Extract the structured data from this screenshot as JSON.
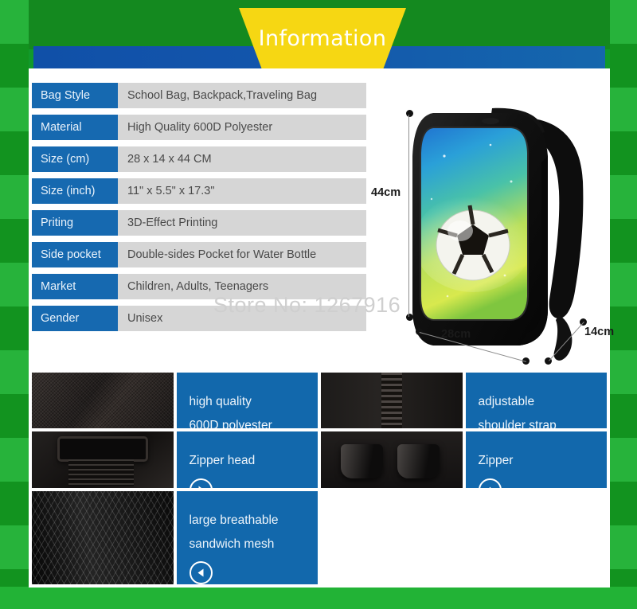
{
  "header": {
    "title": "Information"
  },
  "watermark": {
    "text": "Store No: 1267916"
  },
  "spec_table": {
    "rows": [
      {
        "label": "Bag Style",
        "value": "School Bag, Backpack,Traveling Bag"
      },
      {
        "label": "Material",
        "value": "High Quality 600D Polyester"
      },
      {
        "label": "Size (cm)",
        "value": "28 x 14 x 44 CM"
      },
      {
        "label": "Size (inch)",
        "value": "11\" x 5.5\" x 17.3\""
      },
      {
        "label": "Priting",
        "value": "3D-Effect Printing"
      },
      {
        "label": "Side pocket",
        "value": "Double-sides Pocket for Water Bottle"
      },
      {
        "label": "Market",
        "value": "Children, Adults, Teenagers"
      },
      {
        "label": "Gender",
        "value": "Unisex"
      }
    ]
  },
  "diagram": {
    "height_label": "44cm",
    "width_label": "28cm",
    "depth_label": "14cm"
  },
  "features": [
    {
      "kind": "photo",
      "texture": "weave",
      "name": "fabric-closeup-photo"
    },
    {
      "kind": "caption",
      "lines": [
        "high quality",
        "600D polyester"
      ],
      "arrow": "left",
      "name": "feature-600d-polyester"
    },
    {
      "kind": "photo",
      "texture": "zipper",
      "name": "zipper-track-photo"
    },
    {
      "kind": "caption",
      "lines": [
        "adjustable",
        "shoulder strap"
      ],
      "arrow": "right",
      "name": "feature-adjustable-shoulder-strap"
    },
    {
      "kind": "photo",
      "texture": "strap",
      "name": "shoulder-strap-buckle-photo"
    },
    {
      "kind": "caption",
      "lines": [
        "Zipper head"
      ],
      "arrow": "right",
      "name": "feature-zipper-head"
    },
    {
      "kind": "photo",
      "texture": "zhead",
      "name": "zipper-head-photo"
    },
    {
      "kind": "caption",
      "lines": [
        "Zipper"
      ],
      "arrow": "up",
      "name": "feature-zipper"
    },
    {
      "kind": "photo",
      "texture": "mesh",
      "name": "sandwich-mesh-photo"
    },
    {
      "kind": "caption",
      "lines": [
        "large breathable",
        "sandwich mesh"
      ],
      "arrow": "left",
      "name": "feature-sandwich-mesh"
    }
  ],
  "colors": {
    "grass_light": "#27b33b",
    "grass_dark": "#12931f",
    "banner_blue": "#1356ac",
    "trapezoid_yellow": "#f6d713",
    "label_blue": "#1669b0",
    "value_gray": "#d6d6d6",
    "tile_blue": "#1268ac"
  }
}
